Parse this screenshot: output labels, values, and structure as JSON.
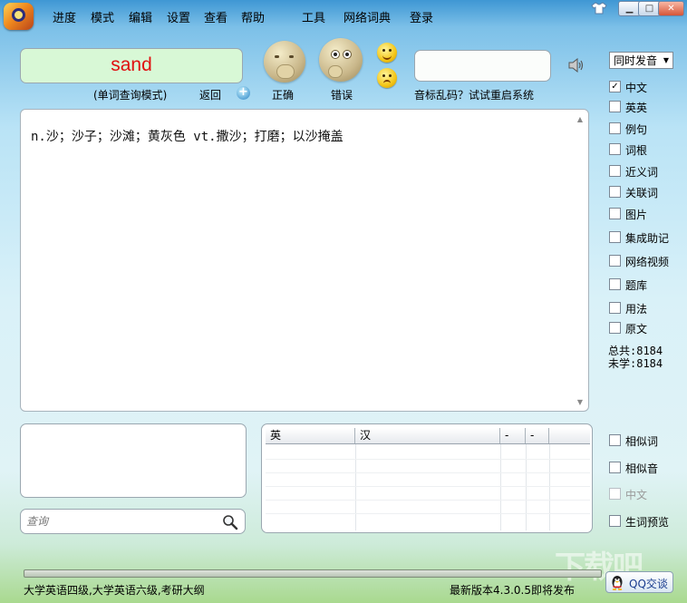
{
  "menubar": {
    "items": [
      "进度",
      "模式",
      "编辑",
      "设置",
      "查看",
      "帮助",
      "工具",
      "网络词典",
      "登录"
    ]
  },
  "window_controls": {
    "skin": "shirt-icon",
    "minimize": "minimize-icon",
    "maximize": "maximize-icon",
    "close": "close-icon"
  },
  "word": {
    "value": "sand",
    "color": "#e01010",
    "mode_label": "(单词查询模式)",
    "back_label": "返回"
  },
  "answer": {
    "correct_label": "正确",
    "wrong_label": "错误"
  },
  "phonetic": {
    "value": "",
    "hint": "音标乱码？试试重启系统"
  },
  "pronunciation_select": {
    "selected": "同时发音"
  },
  "definition": {
    "text": "n.沙；沙子；沙滩；黄灰色 vt.撒沙；打磨；以沙掩盖"
  },
  "display_options": [
    {
      "label": "中文",
      "checked": true
    },
    {
      "label": "英英",
      "checked": false
    },
    {
      "label": "例句",
      "checked": false
    },
    {
      "label": "词根",
      "checked": false
    },
    {
      "label": "近义词",
      "checked": false
    },
    {
      "label": "关联词",
      "checked": false
    },
    {
      "label": "图片",
      "checked": false
    },
    {
      "label": "集成助记",
      "checked": false
    },
    {
      "label": "网络视频",
      "checked": false
    },
    {
      "label": "题库",
      "checked": false
    },
    {
      "label": "用法",
      "checked": false
    },
    {
      "label": "原文",
      "checked": false
    }
  ],
  "stats": {
    "total": "总共:8184",
    "unlearned": "未学:8184"
  },
  "search": {
    "placeholder": "查询"
  },
  "word_table": {
    "headers": [
      "英",
      "汉",
      "-",
      "-"
    ],
    "rows": []
  },
  "bottom_options": [
    {
      "label": "相似词",
      "checked": false,
      "disabled": false
    },
    {
      "label": "相似音",
      "checked": false,
      "disabled": false
    },
    {
      "label": "中文",
      "checked": false,
      "disabled": true
    },
    {
      "label": "生词预览",
      "checked": false,
      "disabled": false
    }
  ],
  "progress": {
    "value": 0
  },
  "status": {
    "books": "大学英语四级,大学英语六级,考研大纲",
    "version_notice": "最新版本4.3.0.5即将发布",
    "qq_button": "QQ交谈"
  },
  "watermark": "下载吧"
}
